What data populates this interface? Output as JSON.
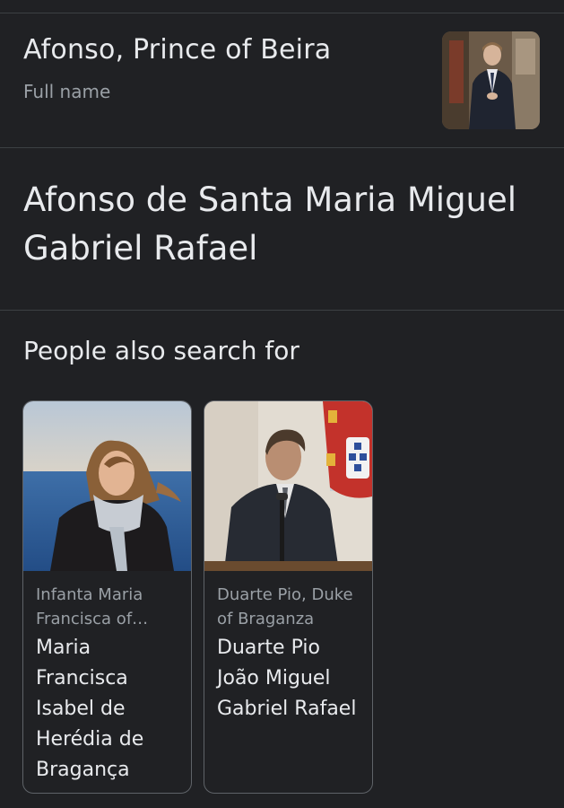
{
  "header": {
    "title": "Afonso, Prince of Beira",
    "subtitle": "Full name"
  },
  "answer": {
    "full_name": "Afonso de Santa Maria Miguel Gabriel Rafael"
  },
  "related": {
    "title": "People also search for",
    "cards": [
      {
        "subtitle": "Infanta Maria Francisca of Braganza",
        "name": "Maria Francisca Isabel de Herédia de Bragança"
      },
      {
        "subtitle": "Duarte Pio, Duke of Braganza",
        "name": "Duarte Pio João Miguel Gabriel Rafael"
      }
    ]
  },
  "colors": {
    "background": "#202124",
    "divider": "#3c4043",
    "text_primary": "#e8eaed",
    "text_secondary": "#9aa0a6",
    "card_border": "#5f6368"
  }
}
